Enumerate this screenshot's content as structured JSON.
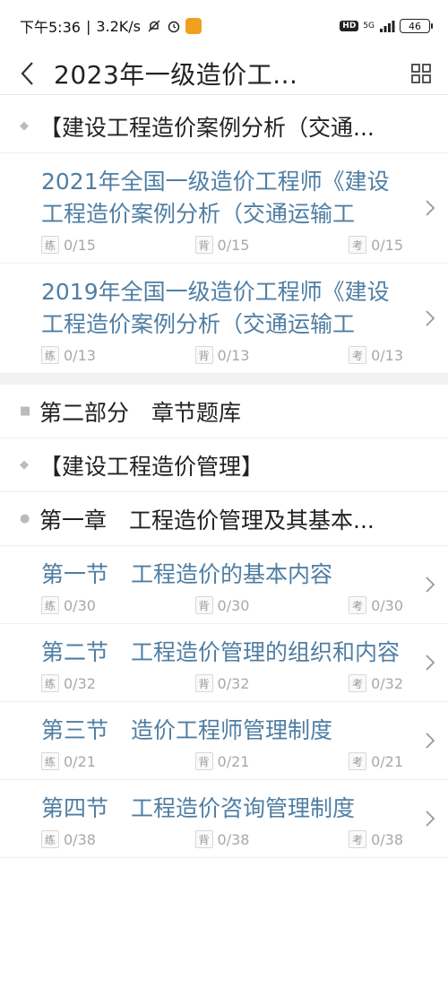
{
  "status_bar": {
    "time": "下午5:36",
    "speed": "3.2K/s",
    "hd_label": "HD",
    "network_top": "5G",
    "battery": "46"
  },
  "header": {
    "title": "2023年一级造价工..."
  },
  "sections": {
    "case_analysis": "【建设工程造价案例分析（交通...",
    "part_two": "第二部分　章节题库",
    "cost_management": "【建设工程造价管理】",
    "chapter_one": "第一章　工程造价管理及其基本..."
  },
  "stat_labels": {
    "practice": "练",
    "memorize": "背",
    "exam": "考"
  },
  "items_group1": [
    {
      "title": "2021年全国一级造价工程师《建设工程造价案例分析（交通运输工",
      "practice": "0/15",
      "memorize": "0/15",
      "exam": "0/15"
    },
    {
      "title": "2019年全国一级造价工程师《建设工程造价案例分析（交通运输工",
      "practice": "0/13",
      "memorize": "0/13",
      "exam": "0/13"
    }
  ],
  "items_group2": [
    {
      "title": "第一节　工程造价的基本内容",
      "practice": "0/30",
      "memorize": "0/30",
      "exam": "0/30"
    },
    {
      "title": "第二节　工程造价管理的组织和内容",
      "practice": "0/32",
      "memorize": "0/32",
      "exam": "0/32"
    },
    {
      "title": "第三节　造价工程师管理制度",
      "practice": "0/21",
      "memorize": "0/21",
      "exam": "0/21"
    },
    {
      "title": "第四节　工程造价咨询管理制度",
      "practice": "0/38",
      "memorize": "0/38",
      "exam": "0/38"
    }
  ]
}
